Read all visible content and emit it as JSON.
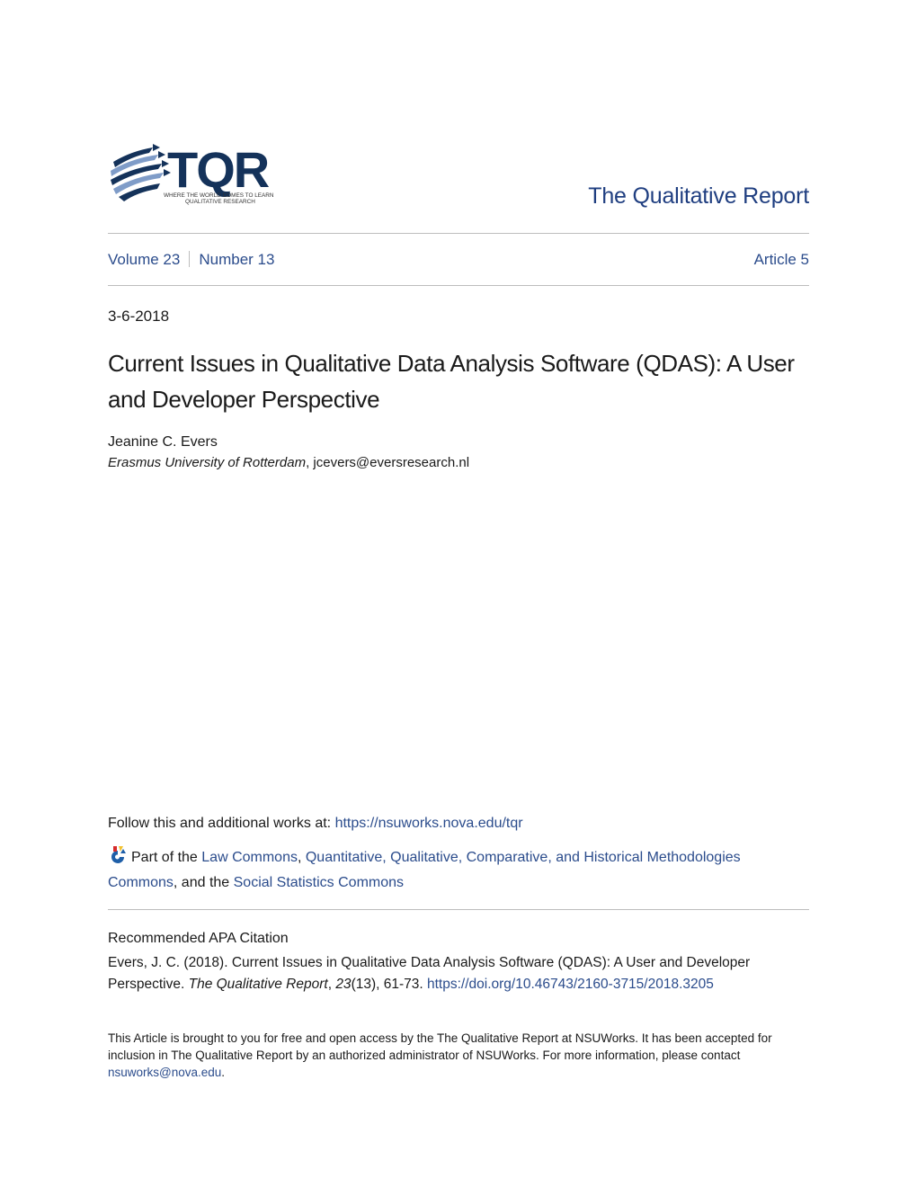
{
  "header": {
    "logo": {
      "wordmark": "TQR",
      "tagline_line1": "WHERE THE WORLD COMES TO LEARN",
      "tagline_line2": "QUALITATIVE RESEARCH",
      "icon": "globe-arrows-icon"
    },
    "journal_title": "The Qualitative Report"
  },
  "issue": {
    "volume": "Volume 23",
    "number": "Number 13",
    "article": "Article 5"
  },
  "date": "3-6-2018",
  "article_title": "Current Issues in Qualitative Data Analysis Software (QDAS): A User and Developer Perspective",
  "author": {
    "name": "Jeanine C. Evers",
    "affiliation": "Erasmus University of Rotterdam",
    "separator": ", ",
    "email": "jcevers@eversresearch.nl"
  },
  "follow": {
    "prefix": "Follow this and additional works at: ",
    "url": "https://nsuworks.nova.edu/tqr"
  },
  "part_of": {
    "icon": "network-commons-icon",
    "prefix": "Part of the ",
    "link1": "Law Commons",
    "sep1": ", ",
    "link2": "Quantitative, Qualitative, Comparative, and Historical Methodologies Commons",
    "sep2": ", and the ",
    "link3": "Social Statistics Commons"
  },
  "citation": {
    "heading": "Recommended APA Citation",
    "text_start": "Evers, J. C. (2018). Current Issues in Qualitative Data Analysis Software (QDAS): A User and Developer Perspective. ",
    "journal": "The Qualitative Report",
    "sep": ", ",
    "volume": "23",
    "issue_pages": "(13), 61-73. ",
    "doi": "https://doi.org/10.46743/2160-3715/2018.3205"
  },
  "footer": {
    "text": "This Article is brought to you for free and open access by the The Qualitative Report at NSUWorks. It has been accepted for inclusion in The Qualitative Report by an authorized administrator of NSUWorks. For more information, please contact ",
    "email": "nsuworks@nova.edu",
    "end": "."
  },
  "colors": {
    "link": "#2b4c8c",
    "journal_title": "#1f3e80",
    "logo_navy": "#14325a",
    "rule": "#bdbdbd"
  }
}
